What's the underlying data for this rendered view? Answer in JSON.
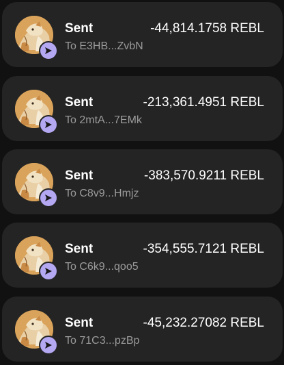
{
  "transactions": [
    {
      "status": "Sent",
      "amount": "-44,814.1758 REBL",
      "address": "To E3HB...ZvbN"
    },
    {
      "status": "Sent",
      "amount": "-213,361.4951 REBL",
      "address": "To 2mtA...7EMk"
    },
    {
      "status": "Sent",
      "amount": "-383,570.9211 REBL",
      "address": "To C8v9...Hmjz"
    },
    {
      "status": "Sent",
      "amount": "-354,555.7121 REBL",
      "address": "To C6k9...qoo5"
    },
    {
      "status": "Sent",
      "amount": "-45,232.27082 REBL",
      "address": "To 71C3...pzBp"
    }
  ],
  "icons": {
    "avatar": "rebl-token-avatar",
    "badge": "send-arrow-icon"
  },
  "colors": {
    "background": "#111111",
    "card": "#242424",
    "badge": "#b4a8f3",
    "secondary_text": "#9b9b9b"
  }
}
